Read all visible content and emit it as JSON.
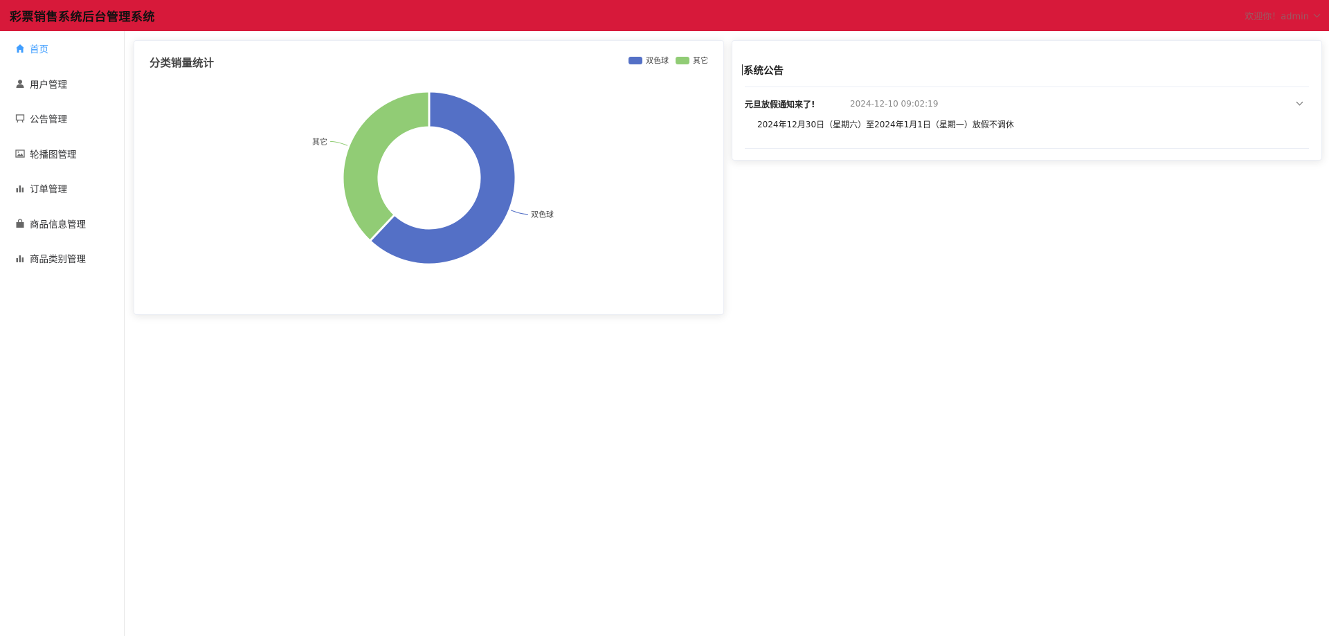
{
  "header": {
    "title": "彩票销售系统后台管理系统",
    "user_label": "欢迎你！admin"
  },
  "sidebar": {
    "items": [
      {
        "label": "首页",
        "icon": "home-icon",
        "active": true
      },
      {
        "label": "用户管理",
        "icon": "user-icon",
        "active": false
      },
      {
        "label": "公告管理",
        "icon": "notice-board-icon",
        "active": false
      },
      {
        "label": "轮播图管理",
        "icon": "picture-icon",
        "active": false
      },
      {
        "label": "订单管理",
        "icon": "bar-chart-icon",
        "active": false
      },
      {
        "label": "商品信息管理",
        "icon": "shopping-bag-icon",
        "active": false
      },
      {
        "label": "商品类别管理",
        "icon": "bar-chart-icon",
        "active": false
      }
    ]
  },
  "colors": {
    "header_bg": "#d7193a",
    "active": "#409eff",
    "series_1": "#5470c6",
    "series_2": "#91cc75"
  },
  "chart_data": {
    "type": "pie",
    "title": "分类销量统计",
    "legend_position": "top-right",
    "categories": [
      "双色球",
      "其它"
    ],
    "values": [
      62,
      38
    ],
    "donut": true
  },
  "notice": {
    "title": "系统公告",
    "items": [
      {
        "title": "元旦放假通知来了!",
        "date": "2024-12-10 09:02:19",
        "content": "2024年12月30日（星期六）至2024年1月1日（星期一）放假不调休"
      }
    ]
  }
}
